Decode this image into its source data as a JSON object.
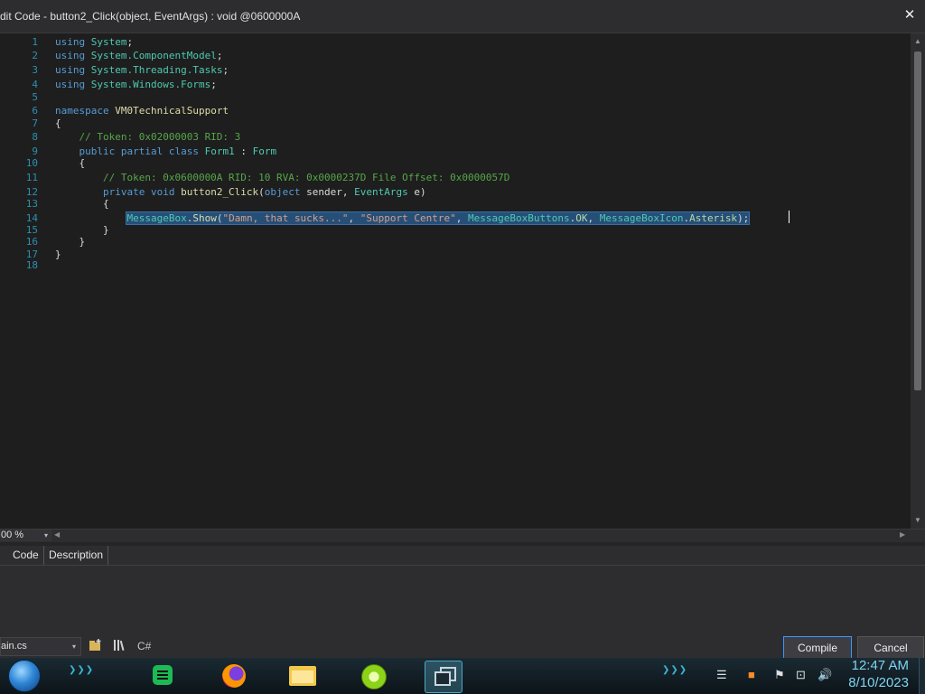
{
  "window": {
    "title": "dit Code - button2_Click(object, EventArgs) : void @0600000A",
    "close_glyph": "✕"
  },
  "editor": {
    "line_numbers": [
      "1",
      "2",
      "3",
      "4",
      "5",
      "6",
      "7",
      "8",
      "9",
      "10",
      "11",
      "12",
      "13",
      "14",
      "15",
      "16",
      "17",
      "18"
    ],
    "lines": {
      "l1": {
        "kw": "using ",
        "ns": "System",
        "end": ";"
      },
      "l2": {
        "kw": "using ",
        "ns": "System.ComponentModel",
        "end": ";"
      },
      "l3": {
        "kw": "using ",
        "ns": "System.Threading.Tasks",
        "end": ";"
      },
      "l4": {
        "kw": "using ",
        "ns": "System.Windows.Forms",
        "end": ";"
      },
      "l6": {
        "kw": "namespace ",
        "ns": "VM0TechnicalSupport"
      },
      "l7": "{",
      "l8": "    // Token: 0x02000003 RID: 3",
      "l9": {
        "indent": "    ",
        "kw": "public partial class ",
        "cls": "Form1",
        "sep": " : ",
        "base": "Form"
      },
      "l10": "    {",
      "l11": "        // Token: 0x0600000A RID: 10 RVA: 0x0000237D File Offset: 0x0000057D",
      "l12": {
        "indent": "        ",
        "kw": "private void ",
        "mth": "button2_Click",
        "open": "(",
        "t1": "object",
        "p1": " sender, ",
        "t2": "EventArgs",
        "p2": " e)"
      },
      "l13": "        {",
      "l14": {
        "indent": "            ",
        "cls": "MessageBox",
        "dot1": ".",
        "mth": "Show",
        "open": "(",
        "s1": "\"Damn, that sucks...\"",
        "c1": ", ",
        "s2": "\"Support Centre\"",
        "c2": ", ",
        "e1": "MessageBoxButtons",
        "dot2": ".",
        "v1": "OK",
        "c3": ", ",
        "e2": "MessageBoxIcon",
        "dot3": ".",
        "v2": "Asterisk",
        "end": ");"
      },
      "l15": "        }",
      "l16": "    }",
      "l17": "}"
    }
  },
  "zoom": {
    "value": "00 %",
    "arrow": "▾"
  },
  "error_list": {
    "columns": [
      "Code",
      "Description"
    ]
  },
  "toolbar": {
    "file": "ain.cs",
    "file_arrow": "▾",
    "compile_label": "Compile",
    "cancel_label": "Cancel",
    "lang_label": "C#"
  },
  "taskbar": {
    "time": "12:47 AM",
    "date": "8/10/2023",
    "deco": "❯❯❯"
  },
  "colors": {
    "selection": "#264f78",
    "keyword": "#569cd6",
    "type": "#4ec9b0",
    "comment": "#57a64a",
    "string": "#d69d85",
    "clock": "#7fd3f2"
  }
}
